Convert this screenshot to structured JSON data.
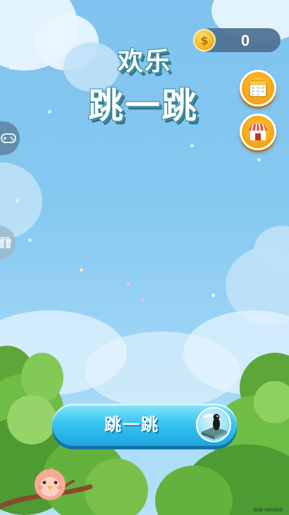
{
  "header": {
    "coin_count": "0",
    "coin_symbol": "$"
  },
  "title": {
    "line1": "欢乐",
    "line2": "跳一跳"
  },
  "menu": {
    "calendar_icon": "calendar-icon",
    "shop_icon": "shop-icon",
    "side_tab_top_icon": "gamepad-icon",
    "side_tab_bottom_icon": "gift-icon"
  },
  "main_button": {
    "label": "跳一跳",
    "badge_icon": "penguin-on-book-icon"
  },
  "footer": {
    "watermark": "trial version"
  },
  "colors": {
    "sky": "#86c9f1",
    "button_blue": "#38c6f1",
    "orange": "#f5a313",
    "title_outline": "#3b8a9c",
    "coin_bar": "#4d6f8f"
  }
}
